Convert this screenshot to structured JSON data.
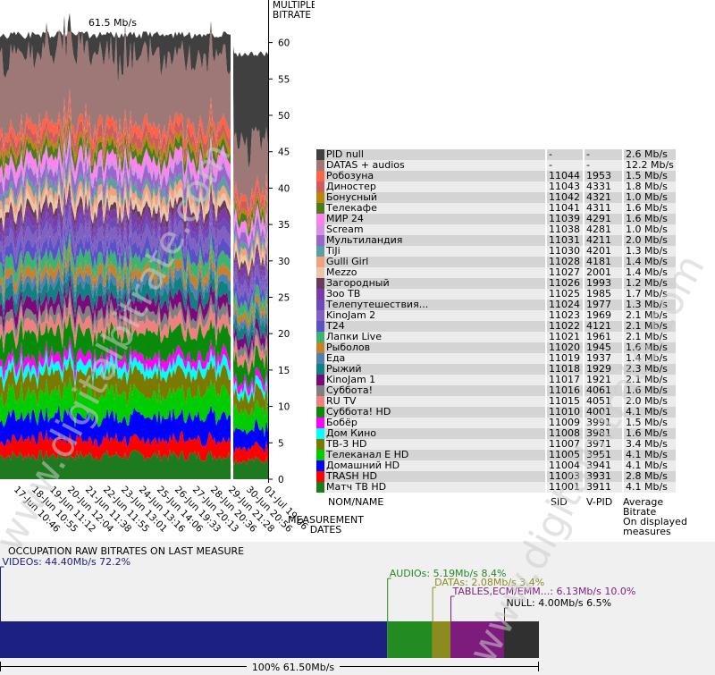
{
  "chart_data": {
    "type": "area",
    "stacked": true,
    "peak_label": "61.5 Mb/s",
    "y_axis_title": [
      "MULTIPLEX",
      "BITRATE"
    ],
    "ylim": [
      0,
      62
    ],
    "y_ticks": [
      0,
      5,
      10,
      15,
      20,
      25,
      30,
      35,
      40,
      45,
      50,
      55,
      60
    ],
    "x_ticks": [
      "17-Jun 10:46",
      "18-Jun 10:55",
      "19-Jun 11:12",
      "20-Jun 12:04",
      "21-Jun 11:38",
      "22-Jun 11:55",
      "23-Jun 13:01",
      "24-Jun 13:16",
      "25-Jun 14:06",
      "26-Jun 19:33",
      "27-Jun 20:13",
      "28-Jun 20:36",
      "29-Jun 21:28",
      "30-Jun 20:56",
      "01-Jul 19:06"
    ],
    "x_axis_title": [
      "MEASUREMENT",
      "DATES"
    ],
    "grid": false
  },
  "legend": {
    "headers": {
      "name": "NOM/NAME",
      "sid": "SID",
      "vpid": "V-PID",
      "rate": [
        "Average",
        "Bitrate",
        "On displayed",
        "measures"
      ]
    },
    "rows": [
      {
        "name": "PID null",
        "sid": "-",
        "vpid": "-",
        "rate": "2.6 Mb/s",
        "color": "#404040"
      },
      {
        "name": "DATAS + audios",
        "sid": "-",
        "vpid": "-",
        "rate": "12.2 Mb/s",
        "color": "#9e7777"
      },
      {
        "name": "Робозуна",
        "sid": "11044",
        "vpid": "1953",
        "rate": "1.5 Mb/s",
        "color": "#ff6347"
      },
      {
        "name": "Диностер",
        "sid": "11043",
        "vpid": "4331",
        "rate": "1.8 Mb/s",
        "color": "#cd5c5c"
      },
      {
        "name": "Бонусный",
        "sid": "11042",
        "vpid": "4321",
        "rate": "1.0 Mb/s",
        "color": "#b8860b"
      },
      {
        "name": "Телекафе",
        "sid": "11041",
        "vpid": "4311",
        "rate": "1.6 Mb/s",
        "color": "#4d7a1a"
      },
      {
        "name": "МИР 24",
        "sid": "11039",
        "vpid": "4291",
        "rate": "1.6 Mb/s",
        "color": "#ff80f0"
      },
      {
        "name": "Scream",
        "sid": "11038",
        "vpid": "4281",
        "rate": "1.0 Mb/s",
        "color": "#d890e0"
      },
      {
        "name": "Мультиландия",
        "sid": "11031",
        "vpid": "4211",
        "rate": "2.0 Mb/s",
        "color": "#9966cc"
      },
      {
        "name": "TiJi",
        "sid": "11030",
        "vpid": "4201",
        "rate": "1.3 Mb/s",
        "color": "#5aa0a0"
      },
      {
        "name": "Gulli Girl",
        "sid": "11028",
        "vpid": "4181",
        "rate": "1.4 Mb/s",
        "color": "#f4a080"
      },
      {
        "name": "Mezzo",
        "sid": "11027",
        "vpid": "2001",
        "rate": "1.4 Mb/s",
        "color": "#e8c8a8"
      },
      {
        "name": "Загородный",
        "sid": "11026",
        "vpid": "1993",
        "rate": "1.2 Mb/s",
        "color": "#6a3a5a"
      },
      {
        "name": "Зоо ТВ",
        "sid": "11025",
        "vpid": "1985",
        "rate": "1.7 Mb/s",
        "color": "#7a3aa8"
      },
      {
        "name": "Телепутешествия...",
        "sid": "11024",
        "vpid": "1977",
        "rate": "1.3 Mb/s",
        "color": "#6a4ab8"
      },
      {
        "name": "KinoJam 2",
        "sid": "11023",
        "vpid": "1969",
        "rate": "2.1 Mb/s",
        "color": "#8060c0"
      },
      {
        "name": "T24",
        "sid": "11022",
        "vpid": "4121",
        "rate": "2.1 Mb/s",
        "color": "#5a50c8"
      },
      {
        "name": "Лапки Live",
        "sid": "11021",
        "vpid": "1961",
        "rate": "2.1 Mb/s",
        "color": "#3cb371"
      },
      {
        "name": "Рыболов",
        "sid": "11020",
        "vpid": "1945",
        "rate": "1.6 Mb/s",
        "color": "#c8802a"
      },
      {
        "name": "Еда",
        "sid": "11019",
        "vpid": "1937",
        "rate": "1.4 Mb/s",
        "color": "#5080b0"
      },
      {
        "name": "Рыжий",
        "sid": "11018",
        "vpid": "1929",
        "rate": "2.3 Mb/s",
        "color": "#108080"
      },
      {
        "name": "KinoJam 1",
        "sid": "11017",
        "vpid": "1921",
        "rate": "2.1 Mb/s",
        "color": "#7a0a7a"
      },
      {
        "name": "Суббота!",
        "sid": "11016",
        "vpid": "4061",
        "rate": "1.6 Mb/s",
        "color": "#808080"
      },
      {
        "name": "RU TV",
        "sid": "11015",
        "vpid": "4051",
        "rate": "2.0 Mb/s",
        "color": "#f08080"
      },
      {
        "name": "Суббота! HD",
        "sid": "11010",
        "vpid": "4001",
        "rate": "4.1 Mb/s",
        "color": "#0a8a0a"
      },
      {
        "name": "Бобёр",
        "sid": "11009",
        "vpid": "3991",
        "rate": "1.5 Mb/s",
        "color": "#ff00ff"
      },
      {
        "name": "Дом Кино",
        "sid": "11008",
        "vpid": "3981",
        "rate": "1.6 Mb/s",
        "color": "#00ffff"
      },
      {
        "name": "ТВ-3 HD",
        "sid": "11007",
        "vpid": "3971",
        "rate": "3.4 Mb/s",
        "color": "#7a7a00"
      },
      {
        "name": "Телеканал Е HD",
        "sid": "11005",
        "vpid": "3951",
        "rate": "4.1 Mb/s",
        "color": "#00cc00"
      },
      {
        "name": "Домашний HD",
        "sid": "11004",
        "vpid": "3941",
        "rate": "4.1 Mb/s",
        "color": "#0000ff"
      },
      {
        "name": "TRASH HD",
        "sid": "11003",
        "vpid": "3931",
        "rate": "2.8 Mb/s",
        "color": "#ff0000"
      },
      {
        "name": "Матч ТВ HD",
        "sid": "11001",
        "vpid": "3911",
        "rate": "4.1 Mb/s",
        "color": "#1e7a1e"
      }
    ]
  },
  "occupation": {
    "title": "OCCUPATION RAW BITRATES ON LAST MEASURE",
    "total_label": "100%  61.50Mb/s",
    "segments": [
      {
        "label": "VIDEOs: 44.40Mb/s  72.2%",
        "percent": 72.2,
        "color": "#1c2080"
      },
      {
        "label": "AUDIOs: 5.19Mb/s  8.4%",
        "percent": 8.4,
        "color": "#228b22"
      },
      {
        "label": "DATAs: 2.08Mb/s  3.4%",
        "percent": 3.4,
        "color": "#8b8b20"
      },
      {
        "label": "TABLES,ECM/EMM...: 6.13Mb/s  10.0%",
        "percent": 10.0,
        "color": "#7e1c7e"
      },
      {
        "label": "NULL: 4.00Mb/s  6.5%",
        "percent": 6.5,
        "color": "#303030"
      }
    ]
  },
  "watermark": "www.digitalbitrate.com"
}
